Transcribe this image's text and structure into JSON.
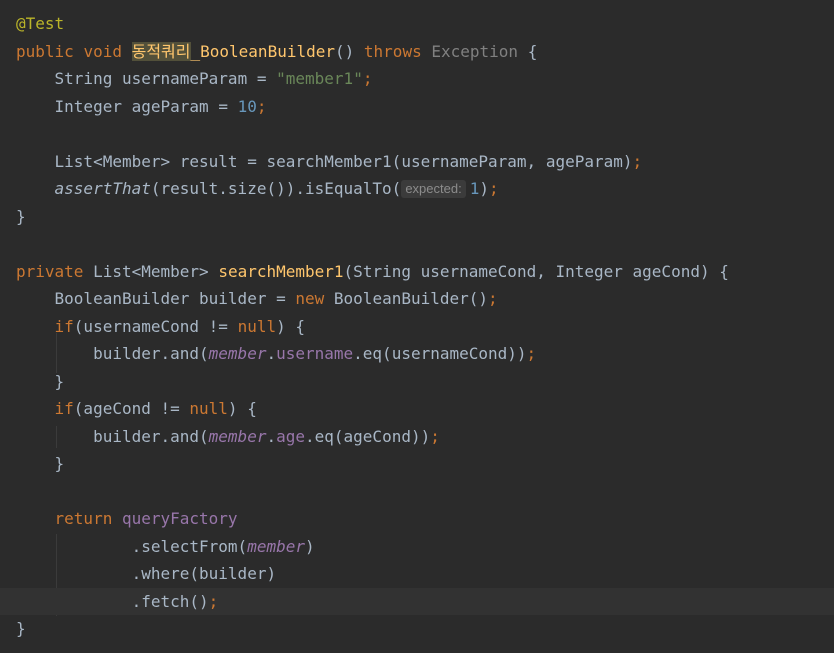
{
  "code": {
    "l1": {
      "annotation": "@Test"
    },
    "l2": {
      "kw_public": "public",
      "kw_void": "void",
      "method_hl": "동적쿼리",
      "method_rest": "_BooleanBuilder",
      "parens": "()",
      "kw_throws": "throws",
      "exception": "Exception",
      "brace": "{"
    },
    "l3": {
      "type": "String",
      "var": "usernameParam",
      "eq": "=",
      "value": "\"member1\"",
      "semi": ";"
    },
    "l4": {
      "type": "Integer",
      "var": "ageParam",
      "eq": "=",
      "value": "10",
      "semi": ";"
    },
    "l6": {
      "decl": "List<Member> result = ",
      "call": "searchMember1(usernameParam, ",
      "arg2": "ageParam)",
      "semi": ";"
    },
    "l7": {
      "fn": "assertThat",
      "mid": "(result.size()).isEqualTo(",
      "hint": "expected:",
      "value": "1",
      "close": ")",
      "semi": ";"
    },
    "l8": {
      "brace": "}"
    },
    "l10": {
      "kw_private": "private",
      "ret": "List<Member>",
      "fn": "searchMember1",
      "params": "(String usernameCond, Integer ageCond) {"
    },
    "l11": {
      "decl": "BooleanBuilder builder = ",
      "kw_new": "new",
      "ctor": "BooleanBuilder()",
      "semi": ";"
    },
    "l12": {
      "kw_if": "if",
      "cond": "(usernameCond != ",
      "kw_null": "null",
      "close": ") {"
    },
    "l13": {
      "pre": "builder.and(",
      "static": "member",
      "dot": ".",
      "field": "username",
      "post": ".eq(usernameCond))",
      "semi": ";"
    },
    "l14": {
      "brace": "}"
    },
    "l15": {
      "kw_if": "if",
      "cond": "(ageCond != ",
      "kw_null": "null",
      "close": ") {"
    },
    "l16": {
      "pre": "builder.and(",
      "static": "member",
      "dot": ".",
      "field": "age",
      "post": ".eq(ageCond))",
      "semi": ";"
    },
    "l17": {
      "brace": "}"
    },
    "l19": {
      "kw_return": "return",
      "field": "queryFactory"
    },
    "l20": {
      "pre": ".selectFrom(",
      "static": "member",
      "close": ")"
    },
    "l21": {
      "text": ".where(builder)"
    },
    "l22": {
      "text": ".fetch()",
      "semi": ";"
    },
    "l23": {
      "brace": "}"
    }
  },
  "colors": {
    "background": "#2b2b2b",
    "current_line": "#323232",
    "keyword": "#cc7832",
    "string": "#6a8759",
    "number": "#6897bb",
    "method": "#ffc66d",
    "field": "#9876aa",
    "annotation": "#bbb529",
    "text": "#a9b7c6"
  }
}
